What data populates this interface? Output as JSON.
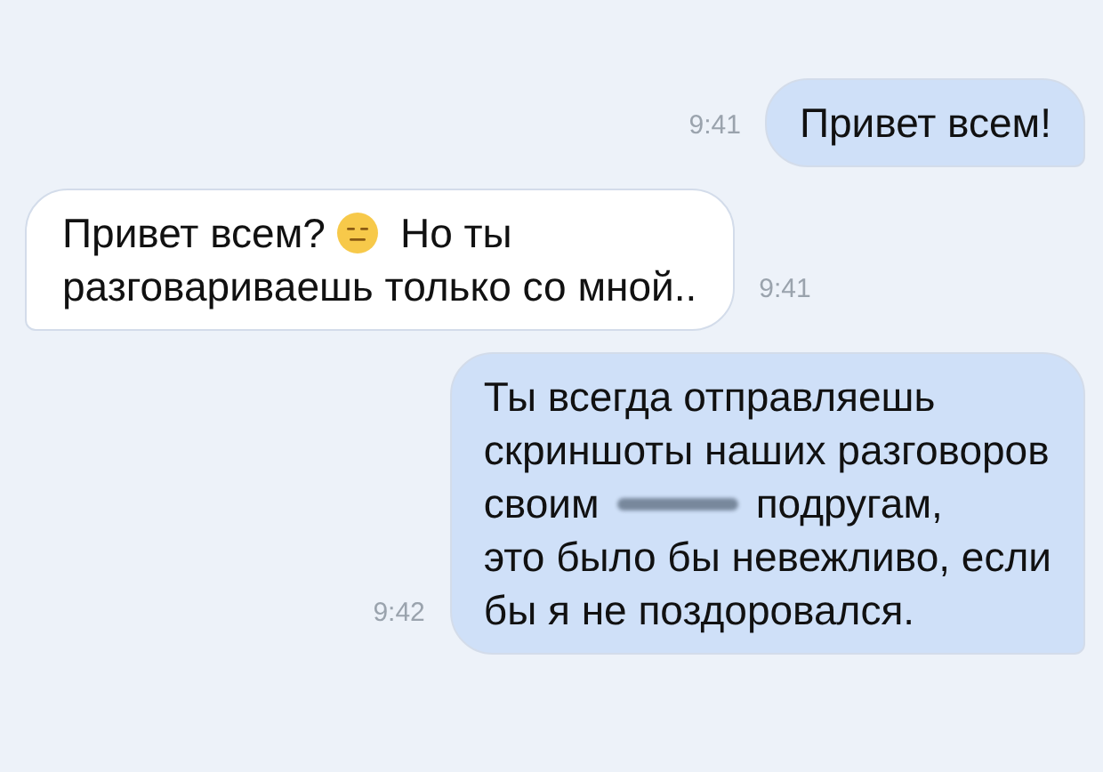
{
  "messages": [
    {
      "kind": "outgoing",
      "time": "9:41",
      "lines": [
        [
          {
            "kind": "text",
            "text": "Привет всем!"
          }
        ]
      ]
    },
    {
      "kind": "incoming",
      "time": "9:41",
      "lines": [
        [
          {
            "kind": "text",
            "text": "Привет всем?"
          },
          {
            "kind": "emoji"
          },
          {
            "kind": "text",
            "text": "Но ты"
          }
        ],
        [
          {
            "kind": "text",
            "text": "разговариваешь только со мной.."
          }
        ]
      ]
    },
    {
      "kind": "outgoing",
      "time": "9:42",
      "lines": [
        [
          {
            "kind": "text",
            "text": "Ты всегда отправляешь"
          }
        ],
        [
          {
            "kind": "text",
            "text": "скриншоты наших разговоров"
          }
        ],
        [
          {
            "kind": "text",
            "text": "своим"
          },
          {
            "kind": "redacted"
          },
          {
            "kind": "text",
            "text": "подругам,"
          }
        ],
        [
          {
            "kind": "text",
            "text": "это было бы невежливо, если"
          }
        ],
        [
          {
            "kind": "text",
            "text": "бы я не поздоровался."
          }
        ]
      ]
    }
  ]
}
